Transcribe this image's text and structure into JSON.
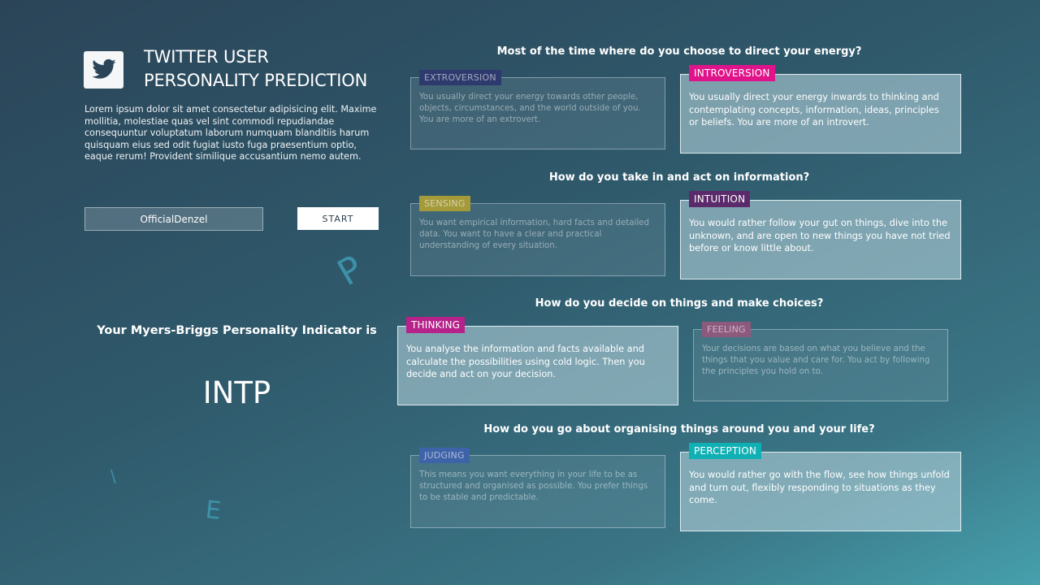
{
  "app": {
    "title_line1": "TWITTER USER",
    "title_line2": "PERSONALITY PREDICTION",
    "logo_icon": "twitter-bird-icon",
    "description": "Lorem ipsum dolor sit amet consectetur adipisicing elit. Maxime mollitia, molestiae quas vel sint commodi repudiandae consequuntur voluptatum laborum numquam blanditiis harum quisquam eius sed odit fugiat iusto fuga praesentium optio, eaque rerum! Provident similique accusantium nemo autem."
  },
  "form": {
    "username_value": "OfficialDenzel",
    "start_label": "START"
  },
  "result": {
    "label": "Your Myers-Briggs Personality Indicator is",
    "value": "INTP"
  },
  "decorative_letters": [
    "P",
    "\\",
    "E"
  ],
  "questions": [
    {
      "text": "Most of the time where do you choose to direct your energy?",
      "options": [
        {
          "tag": "EXTROVERSION",
          "color": "#2e3a6e",
          "active": false,
          "text": "You usually direct your energy towards other people, objects, circumstances, and the world outside of you. You are more of an extrovert."
        },
        {
          "tag": "INTROVERSION",
          "color": "#e0148a",
          "active": true,
          "text": "You usually direct your energy inwards to thinking and contemplating concepts, information, ideas, principles or beliefs. You are more of an introvert."
        }
      ]
    },
    {
      "text": "How do you take in and act on information?",
      "options": [
        {
          "tag": "SENSING",
          "color": "#a49a3a",
          "active": false,
          "text": "You want empirical information, hard facts and detailed data. You want to have a clear and practical understanding of every situation."
        },
        {
          "tag": "INTUITION",
          "color": "#5a2a6a",
          "active": true,
          "text": "You would rather follow your gut on things, dive into the unknown, and are open to new things you have not tried before or know little about."
        }
      ]
    },
    {
      "text": "How do you decide on things and make choices?",
      "options": [
        {
          "tag": "THINKING",
          "color": "#b6218a",
          "active": true,
          "text": "You analyse the information and facts available and calculate the possibilities using cold logic. Then you decide and act on your decision."
        },
        {
          "tag": "FEELING",
          "color": "#8d5a7e",
          "active": false,
          "text": "Your decisions are based on what you believe and the things that you value and care for. You act by following the principles you hold on to."
        }
      ]
    },
    {
      "text": "How do you go about organising things around you and your life?",
      "options": [
        {
          "tag": "JUDGING",
          "color": "#3f63a8",
          "active": false,
          "text": "This means you want everything in your life to be as structured and organised as possible. You prefer things to be stable and predictable."
        },
        {
          "tag": "PERCEPTION",
          "color": "#0fb0b4",
          "active": true,
          "text": "You would rather go with the flow, see how things unfold and turn out, flexibly responding to situations as they come."
        }
      ]
    }
  ]
}
